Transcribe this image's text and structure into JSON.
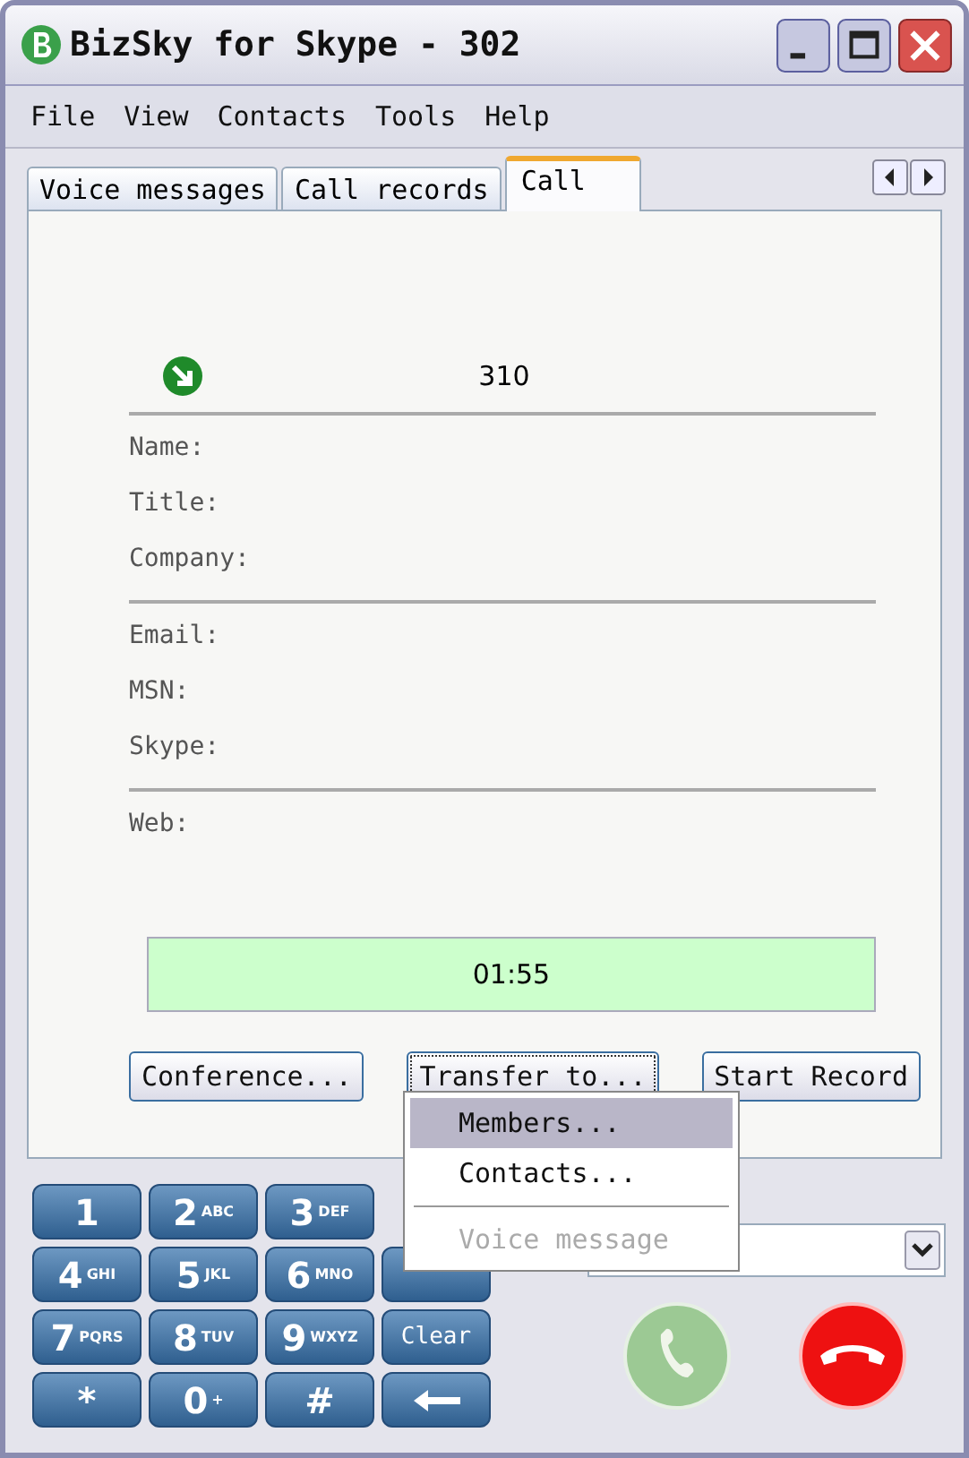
{
  "window": {
    "title": "BizSky for Skype - 302"
  },
  "menu": [
    "File",
    "View",
    "Contacts",
    "Tools",
    "Help"
  ],
  "tabs": [
    {
      "label": "Voice messages",
      "selected": false
    },
    {
      "label": "Call records",
      "selected": false
    },
    {
      "label": "Call",
      "selected": true
    }
  ],
  "caller": {
    "number": "310"
  },
  "field_groups": [
    [
      "Name:",
      "Title:",
      "Company:"
    ],
    [
      "Email:",
      "MSN:",
      "Skype:"
    ],
    [
      "Web:"
    ]
  ],
  "timer": "01:55",
  "actions": [
    {
      "label": "Conference...",
      "selected": false
    },
    {
      "label": "Transfer to...",
      "selected": true
    },
    {
      "label": "Start Record",
      "selected": false
    }
  ],
  "transfer_menu": [
    {
      "kind": "item",
      "label": "Members...",
      "selected": true,
      "disabled": false
    },
    {
      "kind": "item",
      "label": "Contacts...",
      "selected": false,
      "disabled": false
    },
    {
      "kind": "separator"
    },
    {
      "kind": "item",
      "label": "Voice message",
      "selected": false,
      "disabled": true
    }
  ],
  "keypad": [
    [
      {
        "digit": "1"
      },
      {
        "digit": "2",
        "letters": "ABC"
      },
      {
        "digit": "3",
        "letters": "DEF"
      },
      {
        "kind": "hidden"
      }
    ],
    [
      {
        "digit": "4",
        "letters": "GHI"
      },
      {
        "digit": "5",
        "letters": "JKL"
      },
      {
        "digit": "6",
        "letters": "MNO"
      },
      {
        "kind": "covered"
      }
    ],
    [
      {
        "digit": "7",
        "letters": "PQRS"
      },
      {
        "digit": "8",
        "letters": "TUV"
      },
      {
        "digit": "9",
        "letters": "WXYZ"
      },
      {
        "digit": "Clear",
        "kind": "word"
      }
    ],
    [
      {
        "digit": "*"
      },
      {
        "digit": "0",
        "letters": "+"
      },
      {
        "digit": "#"
      },
      {
        "kind": "backspace"
      }
    ]
  ]
}
